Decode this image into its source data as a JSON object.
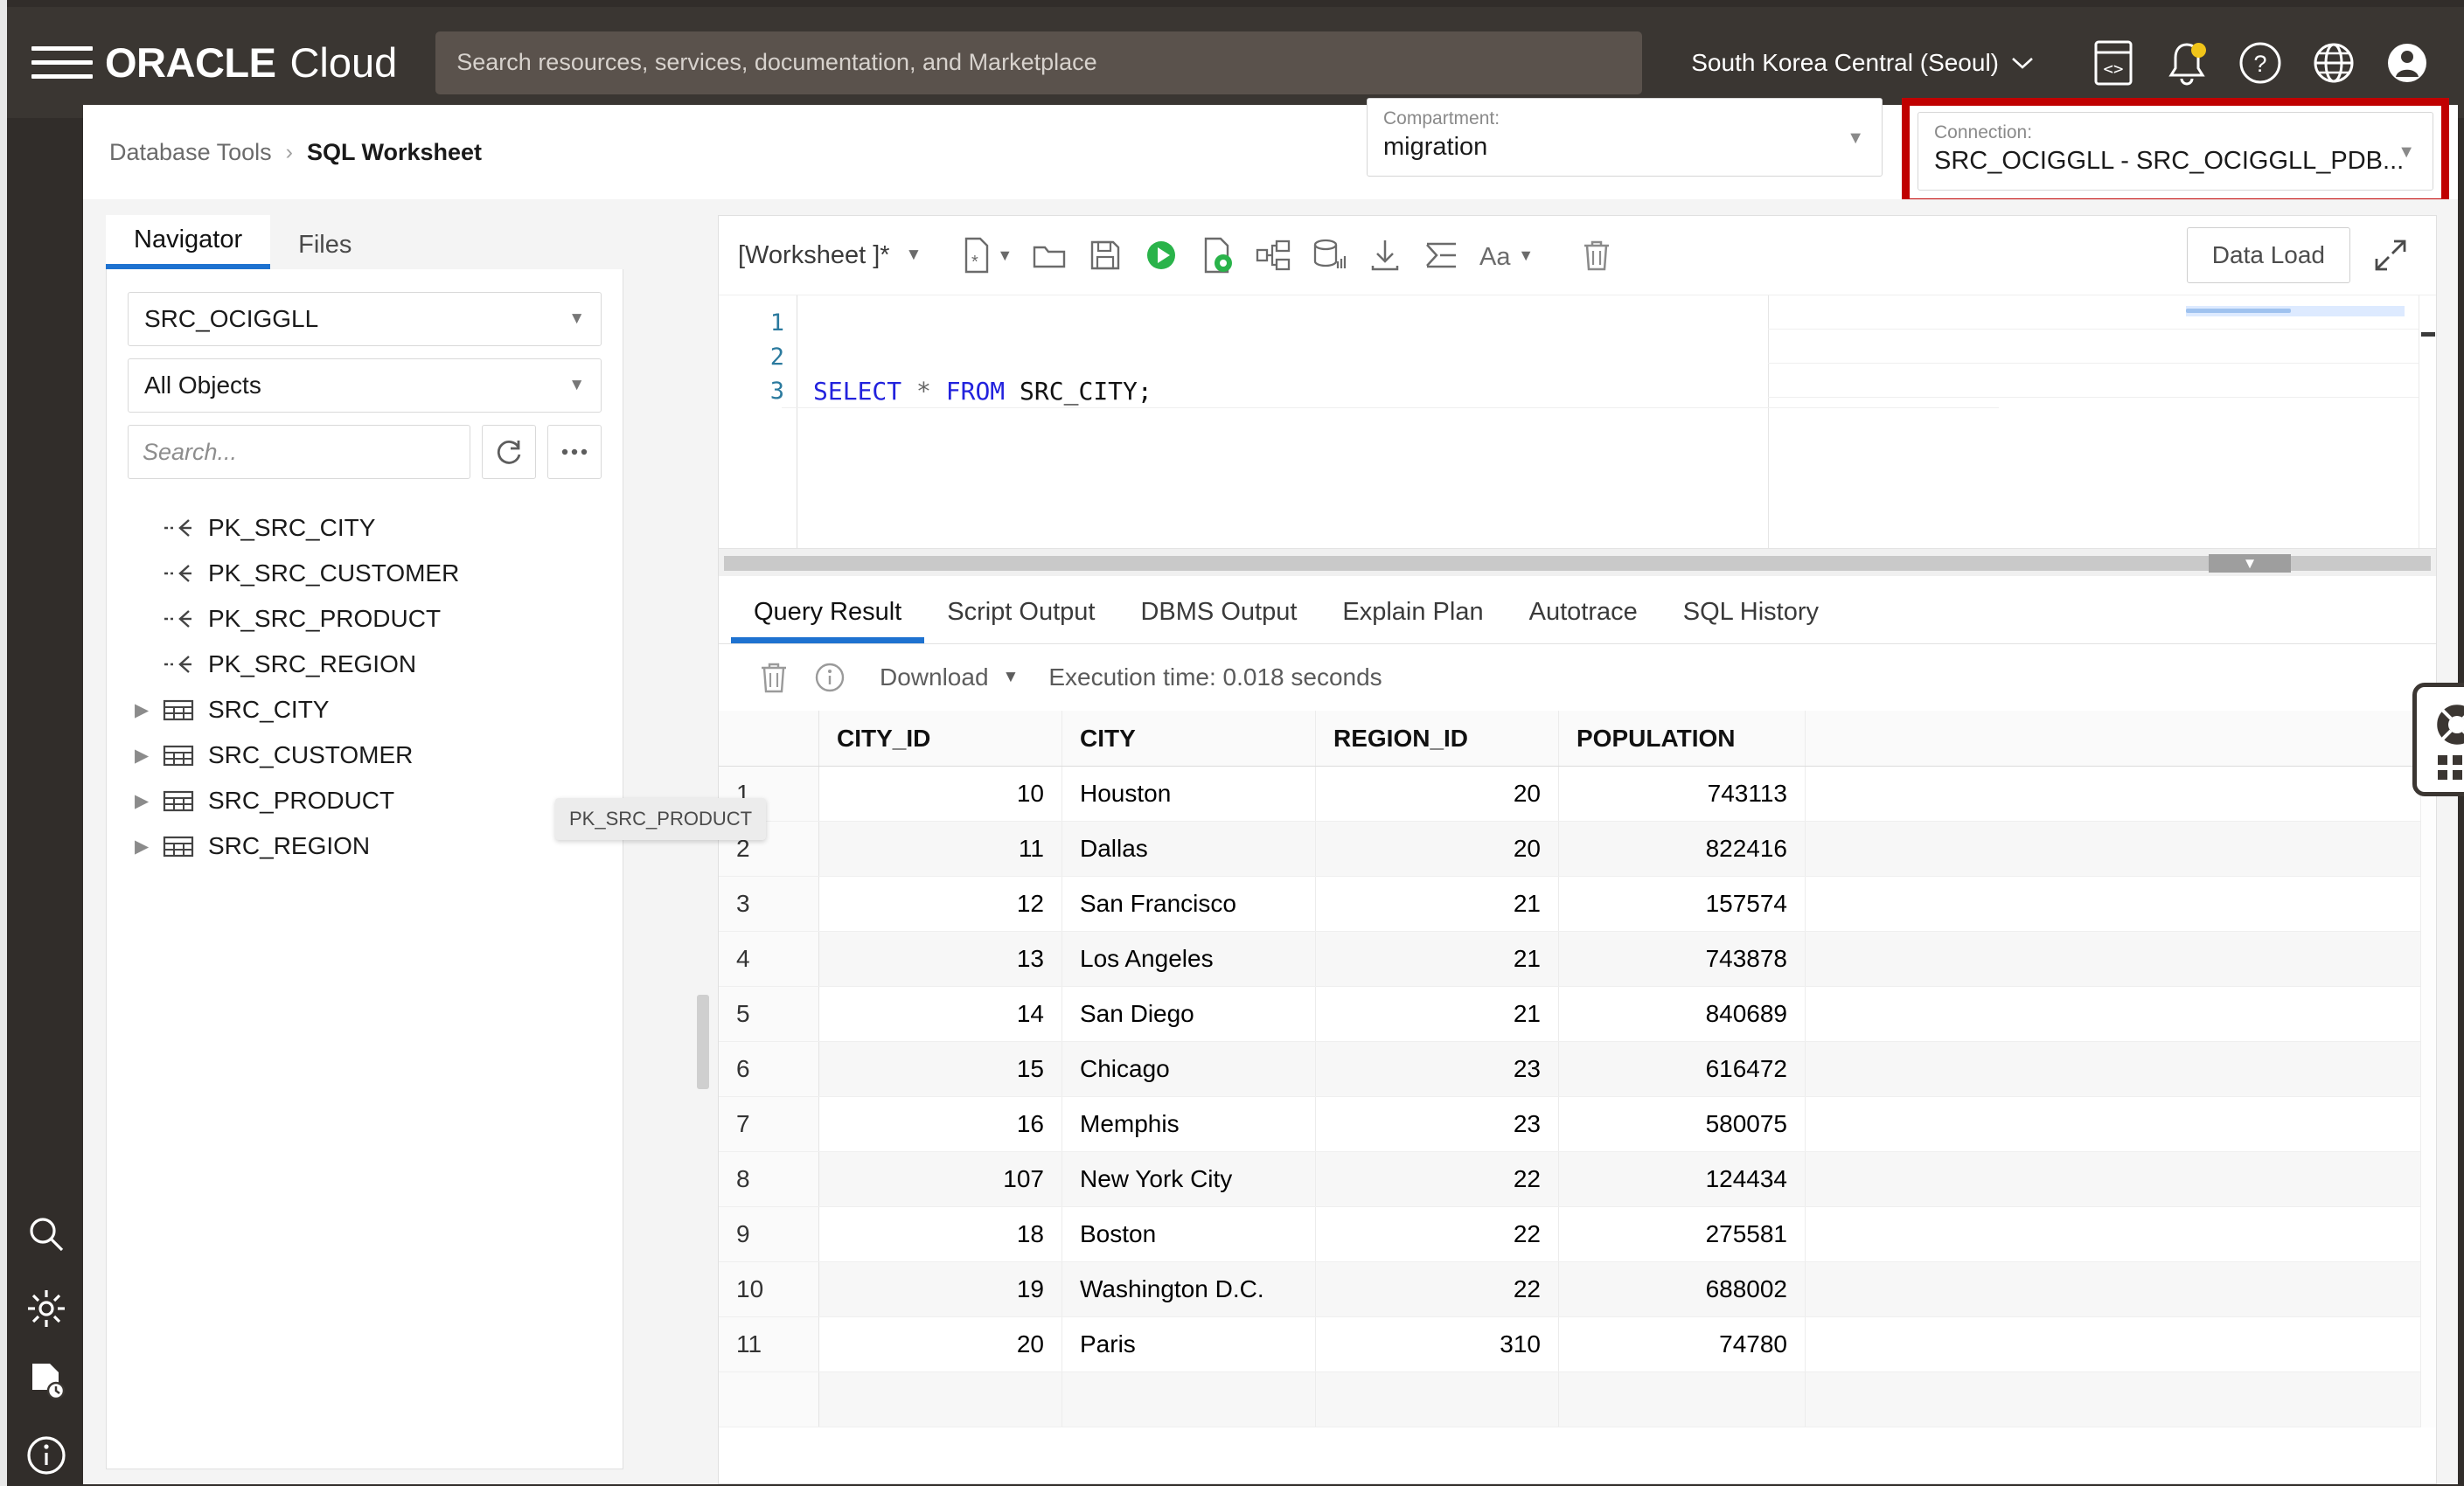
{
  "topbar": {
    "menu_icon": "hamburger-icon",
    "brand_primary": "ORACLE",
    "brand_secondary": "Cloud",
    "search_placeholder": "Search resources, services, documentation, and Marketplace",
    "region": "South Korea Central (Seoul)",
    "region_caret": "⌄",
    "icons": [
      "cloud-shell-icon",
      "notifications-bell-icon",
      "help-question-icon",
      "language-globe-icon",
      "user-avatar-icon"
    ]
  },
  "breadcrumb": {
    "parent": "Database Tools",
    "separator": "›",
    "current": "SQL Worksheet"
  },
  "selectors": {
    "compartment": {
      "label": "Compartment:",
      "value": "migration"
    },
    "connection": {
      "label": "Connection:",
      "value": "SRC_OCIGGLL - SRC_OCIGGLL_PDB..."
    },
    "highlight_color": "#c00000"
  },
  "navigator": {
    "tabs": [
      {
        "label": "Navigator",
        "active": true
      },
      {
        "label": "Files",
        "active": false
      }
    ],
    "schema_select": "SRC_OCIGGLL",
    "object_type_select": "All Objects",
    "search_placeholder": "Search...",
    "refresh_icon": "refresh-icon",
    "more_icon": "more-options-icon",
    "tooltip": "PK_SRC_PRODUCT",
    "tree": [
      {
        "label": "PK_SRC_CITY",
        "icon": "primary-key-icon",
        "expandable": false
      },
      {
        "label": "PK_SRC_CUSTOMER",
        "icon": "primary-key-icon",
        "expandable": false
      },
      {
        "label": "PK_SRC_PRODUCT",
        "icon": "primary-key-icon",
        "expandable": false
      },
      {
        "label": "PK_SRC_REGION",
        "icon": "primary-key-icon",
        "expandable": false
      },
      {
        "label": "SRC_CITY",
        "icon": "table-icon",
        "expandable": true
      },
      {
        "label": "SRC_CUSTOMER",
        "icon": "table-icon",
        "expandable": true
      },
      {
        "label": "SRC_PRODUCT",
        "icon": "table-icon",
        "expandable": true
      },
      {
        "label": "SRC_REGION",
        "icon": "table-icon",
        "expandable": true
      }
    ]
  },
  "worksheet": {
    "name": "[Worksheet ]*",
    "name_caret": "▼",
    "toolbar_icons": [
      "new-worksheet-icon",
      "open-folder-icon",
      "save-icon",
      "run-statement-icon",
      "run-script-icon",
      "explain-plan-icon",
      "autotrace-icon",
      "download-icon",
      "format-icon",
      "text-size-icon",
      "clear-icon"
    ],
    "data_load_button": "Data Load",
    "expand_icon": "expand-diagonal-icon",
    "code_lines": [
      {
        "number": "1",
        "text": ""
      },
      {
        "number": "2",
        "text": ""
      },
      {
        "number": "3",
        "tokens": [
          {
            "t": "SELECT",
            "c": "kw"
          },
          {
            "t": " * ",
            "c": "op"
          },
          {
            "t": "FROM",
            "c": "kw"
          },
          {
            "t": " SRC_CITY;",
            "c": "id"
          }
        ]
      }
    ],
    "splitter_caret": "▼"
  },
  "results": {
    "tabs": [
      {
        "label": "Query Result",
        "active": true
      },
      {
        "label": "Script Output",
        "active": false
      },
      {
        "label": "DBMS Output",
        "active": false
      },
      {
        "label": "Explain Plan",
        "active": false
      },
      {
        "label": "Autotrace",
        "active": false
      },
      {
        "label": "SQL History",
        "active": false
      }
    ],
    "toolbar": {
      "clear_icon": "trash-icon",
      "info_icon": "info-circle-icon",
      "download_label": "Download",
      "download_caret": "▼",
      "execution_time": "Execution time: 0.018 seconds"
    },
    "columns": [
      "CITY_ID",
      "CITY",
      "REGION_ID",
      "POPULATION"
    ],
    "rows": [
      {
        "n": "1",
        "CITY_ID": "10",
        "CITY": "Houston",
        "REGION_ID": "20",
        "POPULATION": "743113"
      },
      {
        "n": "2",
        "CITY_ID": "11",
        "CITY": "Dallas",
        "REGION_ID": "20",
        "POPULATION": "822416"
      },
      {
        "n": "3",
        "CITY_ID": "12",
        "CITY": "San Francisco",
        "REGION_ID": "21",
        "POPULATION": "157574"
      },
      {
        "n": "4",
        "CITY_ID": "13",
        "CITY": "Los Angeles",
        "REGION_ID": "21",
        "POPULATION": "743878"
      },
      {
        "n": "5",
        "CITY_ID": "14",
        "CITY": "San Diego",
        "REGION_ID": "21",
        "POPULATION": "840689"
      },
      {
        "n": "6",
        "CITY_ID": "15",
        "CITY": "Chicago",
        "REGION_ID": "23",
        "POPULATION": "616472"
      },
      {
        "n": "7",
        "CITY_ID": "16",
        "CITY": "Memphis",
        "REGION_ID": "23",
        "POPULATION": "580075"
      },
      {
        "n": "8",
        "CITY_ID": "107",
        "CITY": "New York City",
        "REGION_ID": "22",
        "POPULATION": "124434"
      },
      {
        "n": "9",
        "CITY_ID": "18",
        "CITY": "Boston",
        "REGION_ID": "22",
        "POPULATION": "275581"
      },
      {
        "n": "10",
        "CITY_ID": "19",
        "CITY": "Washington D.C.",
        "REGION_ID": "22",
        "POPULATION": "688002"
      },
      {
        "n": "11",
        "CITY_ID": "20",
        "CITY": "Paris",
        "REGION_ID": "310",
        "POPULATION": "74780"
      }
    ]
  },
  "help_widget": {
    "icon": "life-preserver-icon",
    "grid_icon": "apps-grid-icon"
  },
  "rail": {
    "icons": [
      "search-icon",
      "settings-gear-icon",
      "document-history-icon",
      "info-circle-icon"
    ]
  },
  "theme": {
    "nav_dark": "#3a3632",
    "accent_blue": "#1e72d0",
    "run_green": "#2ab34a"
  }
}
